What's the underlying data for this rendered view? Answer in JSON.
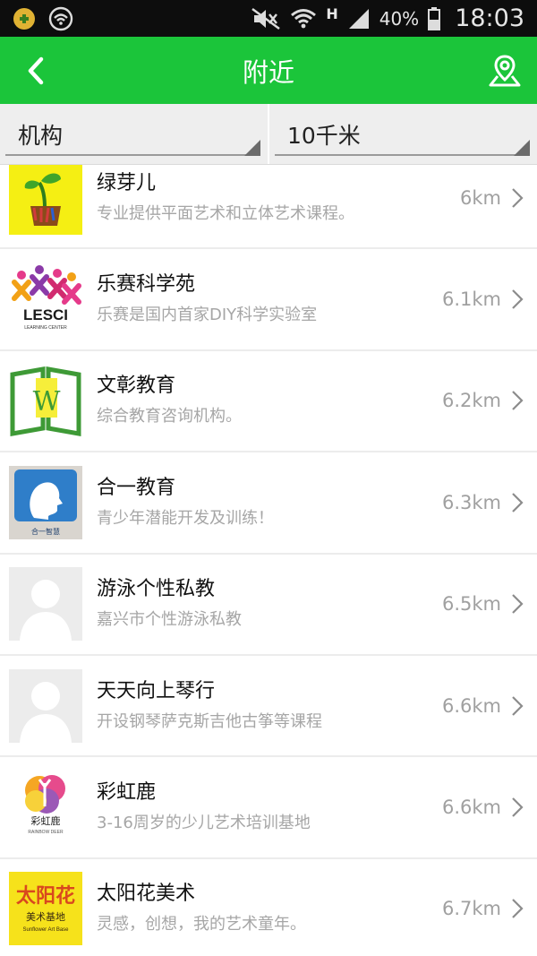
{
  "status": {
    "network": "H",
    "battery": "40%",
    "time": "18:03"
  },
  "nav": {
    "title": "附近"
  },
  "filters": {
    "type": "机构",
    "range": "10千米"
  },
  "items": [
    {
      "name": "绿芽儿",
      "desc": "专业提供平面艺术和立体艺术课程。",
      "distance": "6km"
    },
    {
      "name": "乐赛科学苑",
      "desc": "乐赛是国内首家DIY科学实验室",
      "distance": "6.1km"
    },
    {
      "name": "文彰教育",
      "desc": "综合教育咨询机构。",
      "distance": "6.2km"
    },
    {
      "name": "合一教育",
      "desc": "青少年潜能开发及训练！",
      "distance": "6.3km"
    },
    {
      "name": "游泳个性私教",
      "desc": "嘉兴市个性游泳私教",
      "distance": "6.5km"
    },
    {
      "name": "天天向上琴行",
      "desc": "开设钢琴萨克斯吉他古筝等课程",
      "distance": "6.6km"
    },
    {
      "name": "彩虹鹿",
      "desc": "3-16周岁的少儿艺术培训基地",
      "distance": "6.6km"
    },
    {
      "name": "太阳花美术",
      "desc": "灵感，创想，我的艺术童年。",
      "distance": "6.7km"
    }
  ],
  "logos": {
    "lesci": {
      "title": "LESCI",
      "subtitle": "LEARNING CENTER"
    },
    "wenzhang": {
      "mark": "W"
    },
    "heyi": {
      "caption": "合一智慧"
    },
    "rainbow": {
      "title": "彩虹鹿",
      "subtitle": "RAINBOW DEER"
    },
    "sunflower": {
      "title": "太阳花",
      "line1": "美术基地",
      "line2": "Sunflower Art Base"
    }
  }
}
